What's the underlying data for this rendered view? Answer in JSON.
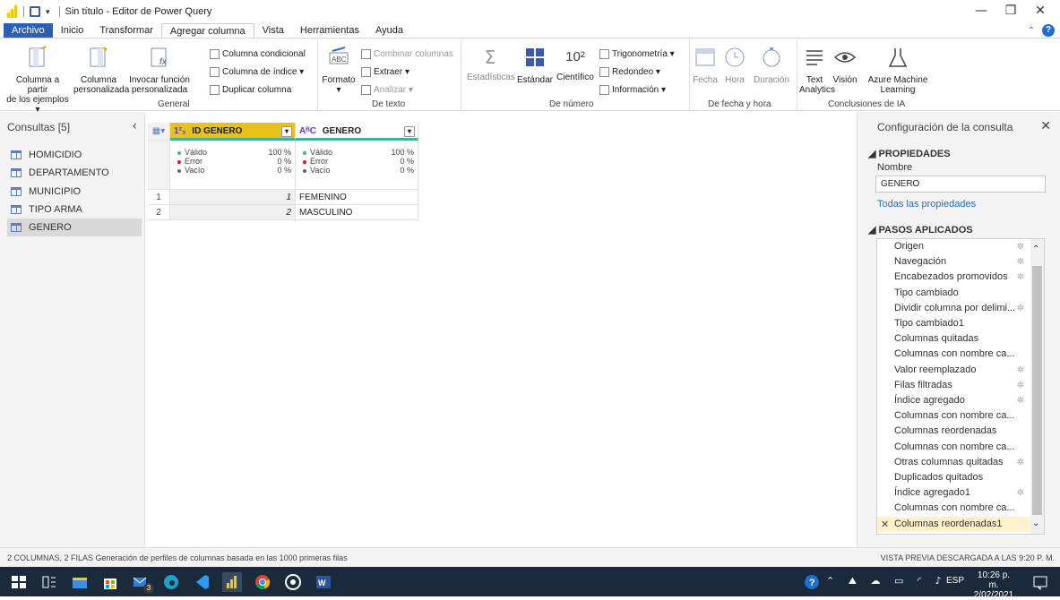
{
  "window": {
    "title": "Sin título - Editor de Power Query",
    "minimize": "—",
    "restore": "❐",
    "close": "✕"
  },
  "menu": {
    "items": [
      "Archivo",
      "Inicio",
      "Transformar",
      "Agregar columna",
      "Vista",
      "Herramientas",
      "Ayuda"
    ],
    "active": "Agregar columna",
    "help": "?"
  },
  "ribbon": {
    "general": {
      "label": "General",
      "col_from_examples": [
        "Columna a partir",
        "de los ejemplos ▾"
      ],
      "custom_col": [
        "Columna",
        "personalizada"
      ],
      "invoke_fn": [
        "Invocar función",
        "personalizada"
      ],
      "conditional": "Columna condicional",
      "index": "Columna de índice ▾",
      "duplicate": "Duplicar columna"
    },
    "text": {
      "label": "De texto",
      "format": "Formato",
      "merge": "Combinar columnas",
      "extract": "Extraer ▾",
      "parse": "Analizar ▾"
    },
    "number": {
      "label": "De número",
      "stats": "Estadísticas",
      "standard": "Estándar",
      "scientific": "Científico",
      "trig": "Trigonometría ▾",
      "round": "Redondeo ▾",
      "info": "Información ▾"
    },
    "datetime": {
      "label": "De fecha y hora",
      "date": "Fecha",
      "time": "Hora",
      "duration": "Duración"
    },
    "ai": {
      "label": "Conclusiones de IA",
      "text_analytics": [
        "Text",
        "Analytics"
      ],
      "vision": "Visión",
      "azure_ml": [
        "Azure Machine",
        "Learning"
      ]
    }
  },
  "queries": {
    "header": "Consultas [5]",
    "items": [
      "HOMICIDIO",
      "DEPARTAMENTO",
      "MUNICIPIO",
      "TIPO ARMA",
      "GENERO"
    ],
    "selected": "GENERO"
  },
  "grid": {
    "columns": [
      {
        "type": "1²₃",
        "name": "ID GENERO",
        "valid": "Válido",
        "valid_pct": "100 %",
        "error": "Error",
        "error_pct": "0 %",
        "empty": "Vacío",
        "empty_pct": "0 %"
      },
      {
        "type": "AᴮC",
        "name": "GENERO",
        "valid": "Válido",
        "valid_pct": "100 %",
        "error": "Error",
        "error_pct": "0 %",
        "empty": "Vacío",
        "empty_pct": "0 %"
      }
    ],
    "rows": [
      {
        "n": "1",
        "id": "1",
        "genero": "FEMENINO"
      },
      {
        "n": "2",
        "id": "2",
        "genero": "MASCULINO"
      }
    ]
  },
  "settings": {
    "title": "Configuración de la consulta",
    "properties": "◢ PROPIEDADES",
    "name_label": "Nombre",
    "name_value": "GENERO",
    "all_props": "Todas las propiedades",
    "applied": "◢ PASOS APLICADOS",
    "steps": [
      {
        "label": "Origen",
        "gear": true
      },
      {
        "label": "Navegación",
        "gear": true
      },
      {
        "label": "Encabezados promovidos",
        "gear": true
      },
      {
        "label": "Tipo cambiado",
        "gear": false
      },
      {
        "label": "Dividir columna por delimi...",
        "gear": true
      },
      {
        "label": "Tipo cambiado1",
        "gear": false
      },
      {
        "label": "Columnas quitadas",
        "gear": false
      },
      {
        "label": "Columnas con nombre ca...",
        "gear": false
      },
      {
        "label": "Valor reemplazado",
        "gear": true
      },
      {
        "label": "Filas filtradas",
        "gear": true
      },
      {
        "label": "Índice agregado",
        "gear": true
      },
      {
        "label": "Columnas con nombre ca...",
        "gear": false
      },
      {
        "label": "Columnas reordenadas",
        "gear": false
      },
      {
        "label": "Columnas con nombre ca...",
        "gear": false
      },
      {
        "label": "Otras columnas quitadas",
        "gear": true
      },
      {
        "label": "Duplicados quitados",
        "gear": false
      },
      {
        "label": "Índice agregado1",
        "gear": true
      },
      {
        "label": "Columnas con nombre ca...",
        "gear": false
      },
      {
        "label": "Columnas reordenadas1",
        "gear": false
      }
    ]
  },
  "status": {
    "left": "2 COLUMNAS, 2 FILAS    Generación de perfiles de columnas basada en las 1000 primeras filas",
    "right": "VISTA PREVIA DESCARGADA A LAS 9:20 P. M."
  },
  "taskbar": {
    "lang": "ESP",
    "time": "10:26 p. m.",
    "date": "2/02/2021",
    "badge": "3"
  },
  "colors": {
    "accent": "#2f5fb3",
    "header_col": "#e8c11a",
    "valid": "#3fb39b",
    "error": "#e81123",
    "taskbar": "#1b2a3a"
  }
}
